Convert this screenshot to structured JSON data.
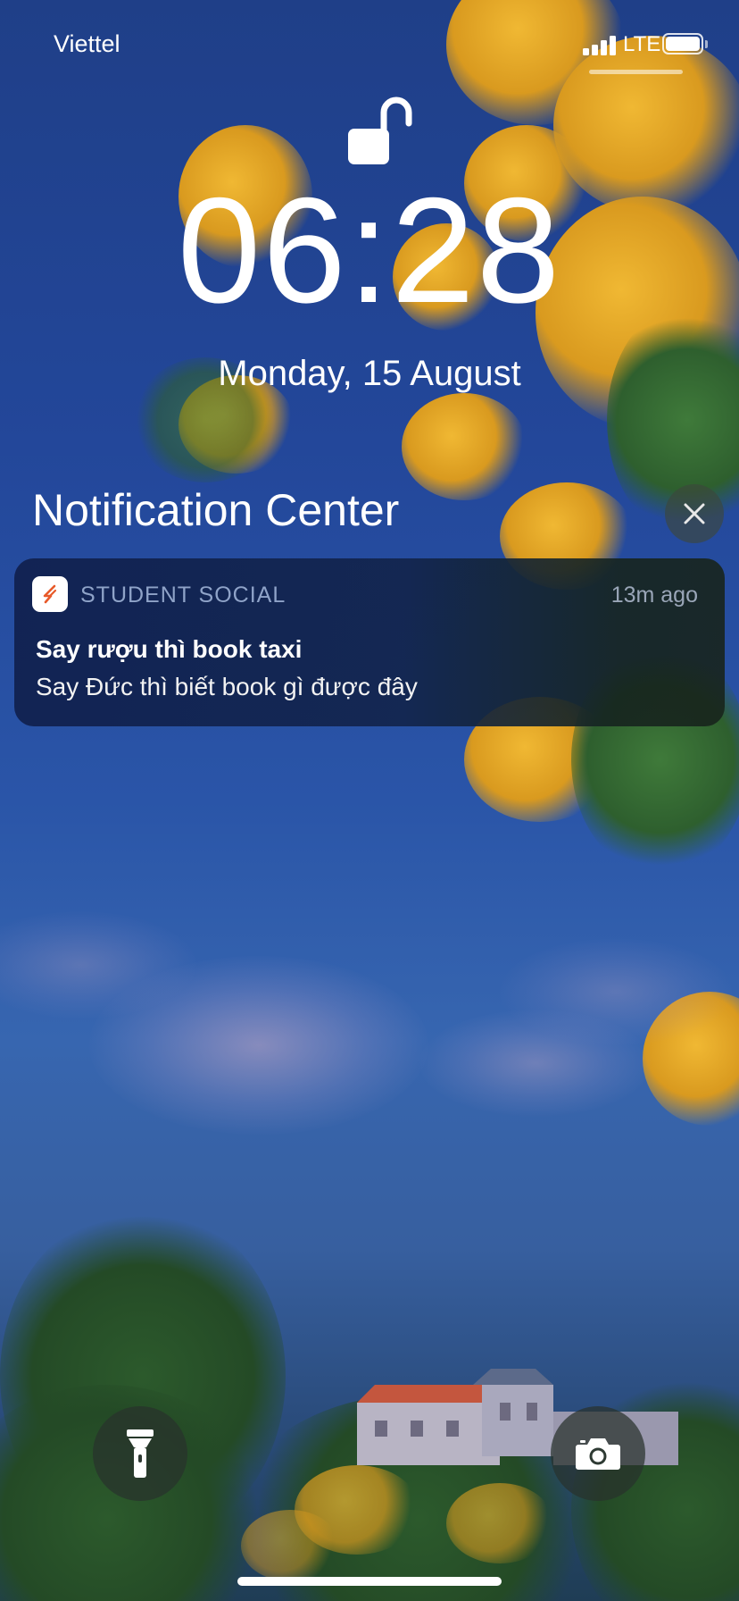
{
  "status_bar": {
    "carrier": "Viettel",
    "network": "LTE",
    "battery_level": 1.0,
    "signal_bars": 4
  },
  "lock_screen": {
    "lock_state": "unlocked",
    "time": "06:28",
    "date": "Monday, 15 August"
  },
  "notification_center": {
    "title": "Notification Center",
    "notifications": [
      {
        "app_name": "STUDENT SOCIAL",
        "time_ago": "13m ago",
        "title": "Say rượu thì book taxi",
        "body": "Say Đức thì biết book gì được đây",
        "icon": "student-social-logo",
        "accent_color": "#e85a2a"
      }
    ]
  },
  "quick_actions": {
    "flashlight_icon": "flashlight-icon",
    "camera_icon": "camera-icon"
  }
}
